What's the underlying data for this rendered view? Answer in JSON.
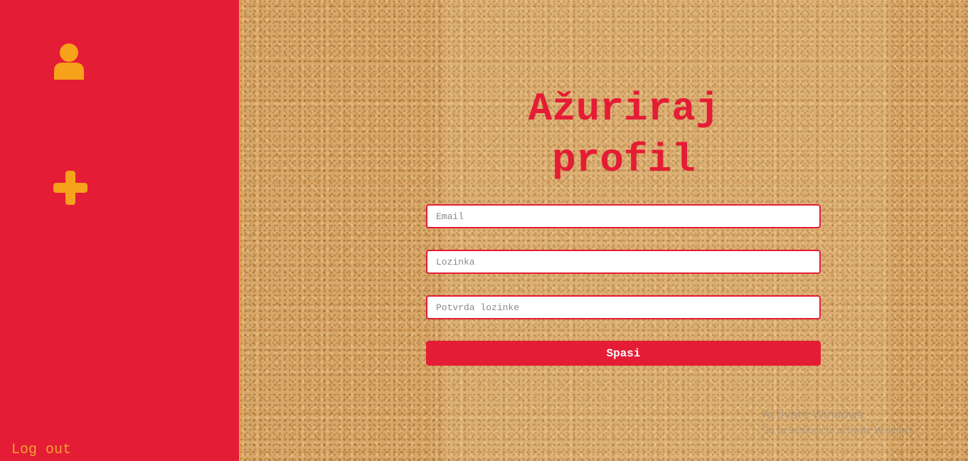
{
  "sidebar": {
    "user_icon": "user-icon",
    "add_icon": "plus-icon",
    "logout_label": "Log out"
  },
  "main": {
    "title_line1": "Ažuriraj",
    "title_line2": "profil",
    "email_placeholder": "Email",
    "password_placeholder": "Lozinka",
    "confirm_placeholder": "Potvrda lozinke",
    "submit_label": "Spasi"
  },
  "watermark": {
    "title": "Activate Windows",
    "subtitle": "Go to Settings to activate Windows."
  },
  "colors": {
    "accent": "#e51c35",
    "icon": "#f0a132",
    "background": "#d9a868"
  }
}
